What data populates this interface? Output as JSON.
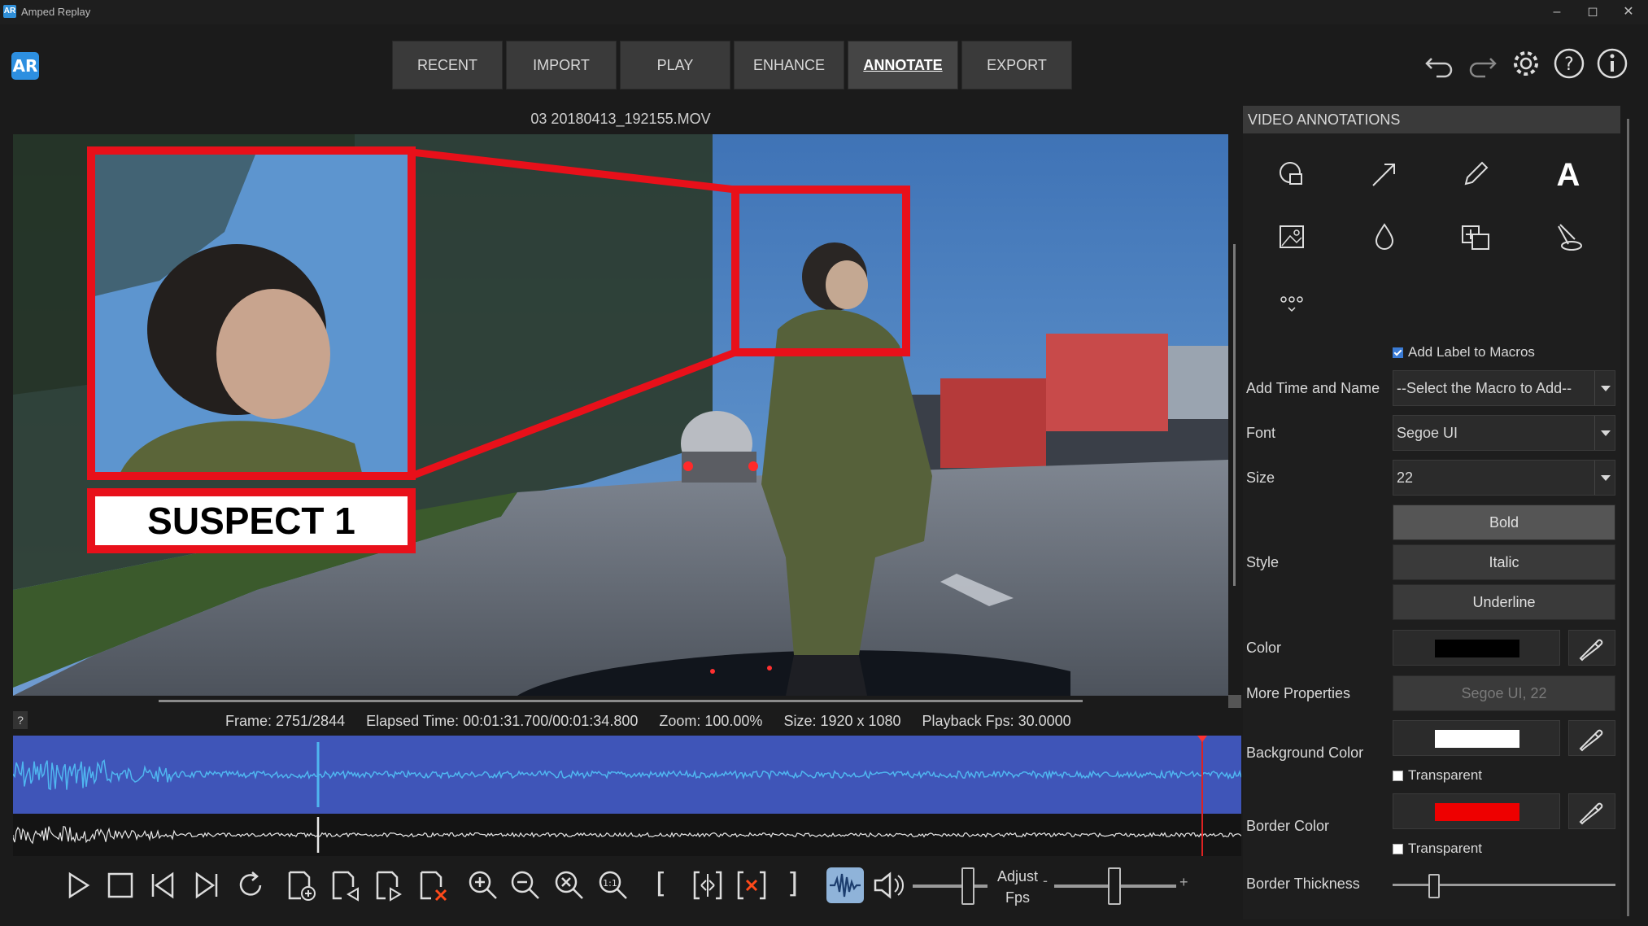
{
  "window": {
    "title": "Amped Replay",
    "app_icon_text": "AR"
  },
  "logo_text": "AR",
  "tabs": [
    {
      "label": "RECENT"
    },
    {
      "label": "IMPORT"
    },
    {
      "label": "PLAY"
    },
    {
      "label": "ENHANCE"
    },
    {
      "label": "ANNOTATE",
      "active": true
    },
    {
      "label": "EXPORT"
    }
  ],
  "toolbar_icons": [
    "undo-icon",
    "redo-icon",
    "gear-icon",
    "help-icon",
    "info-icon"
  ],
  "video": {
    "filename": "03 20180413_192155.MOV",
    "label_text": "SUSPECT 1",
    "annotation_color": "#e8101a"
  },
  "status": {
    "help": "?",
    "frame": "Frame: 2751/2844",
    "elapsed": "Elapsed Time: 00:01:31.700/00:01:34.800",
    "zoom": "Zoom: 100.00%",
    "size": "Size: 1920 x 1080",
    "fps": "Playback Fps: 30.0000"
  },
  "controls": {
    "adjust_label_1": "Adjust",
    "adjust_label_2": "Fps",
    "bracket_open": "[",
    "bracket_close": "]",
    "speed_minus": "-",
    "speed_plus": "+"
  },
  "panel": {
    "title": "VIDEO ANNOTATIONS",
    "tools": [
      "shape-icon",
      "arrow-icon",
      "pencil-icon",
      "text-icon",
      "image-icon",
      "blur-drop-icon",
      "magnify-icon",
      "spotlight-icon",
      "more-tools-icon"
    ],
    "add_label_to_macros": "Add Label to Macros",
    "add_time_label": "Add Time and Name",
    "macro_select": "--Select the Macro to Add--",
    "font_label": "Font",
    "font_value": "Segoe UI",
    "size_label": "Size",
    "size_value": "22",
    "style_label": "Style",
    "bold": "Bold",
    "italic": "Italic",
    "underline": "Underline",
    "color_label": "Color",
    "color_value": "#000000",
    "more_props_label": "More Properties",
    "more_props_value": "Segoe UI, 22",
    "bg_color_label": "Background Color",
    "bg_color_value": "#ffffff",
    "transparent": "Transparent",
    "border_color_label": "Border Color",
    "border_color_value": "#ee0000",
    "border_thickness_label": "Border Thickness"
  }
}
